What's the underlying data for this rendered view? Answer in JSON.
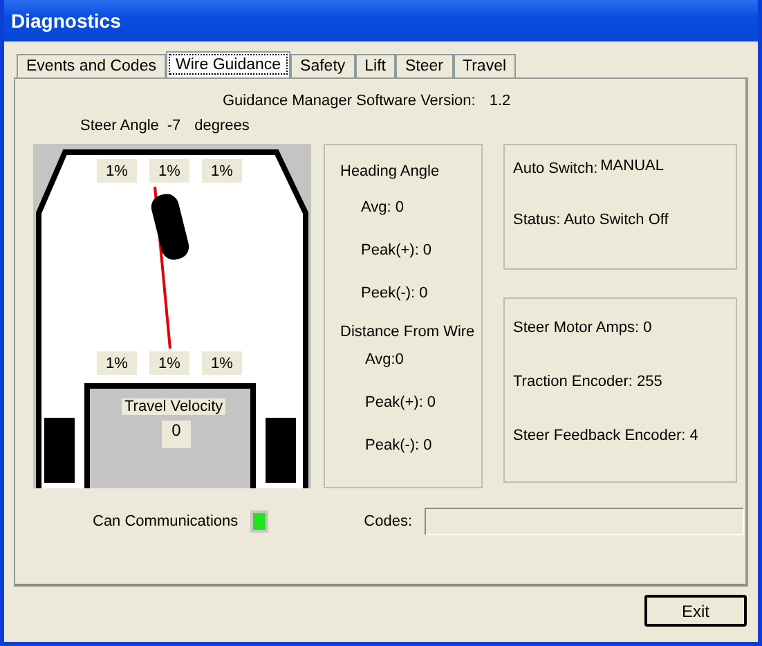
{
  "window": {
    "title": "Diagnostics"
  },
  "tabs": [
    {
      "label": "Events and Codes",
      "selected": false
    },
    {
      "label": "Wire Guidance",
      "selected": true
    },
    {
      "label": "Safety",
      "selected": false
    },
    {
      "label": "Lift",
      "selected": false
    },
    {
      "label": "Steer",
      "selected": false
    },
    {
      "label": "Travel",
      "selected": false
    }
  ],
  "software_version": {
    "label": "Guidance Manager Software Version:",
    "value": "1.2"
  },
  "steer_angle": {
    "label": "Steer Angle",
    "value": "-7",
    "unit": "degrees"
  },
  "diagram": {
    "front_sensors": [
      "1%",
      "1%",
      "1%"
    ],
    "rear_sensors": [
      "1%",
      "1%",
      "1%"
    ],
    "travel_velocity": {
      "label": "Travel Velocity",
      "value": "0"
    }
  },
  "heading_angle": {
    "title": "Heading Angle",
    "rows": [
      "Avg: 0",
      "Peak(+):  0",
      "Peek(-):  0"
    ]
  },
  "distance_from_wire": {
    "title": "Distance From Wire",
    "rows": [
      "Avg:0",
      "Peak(+): 0",
      "Peak(-): 0"
    ]
  },
  "auto_switch": {
    "label": "Auto Switch:",
    "value": "MANUAL",
    "status": "Status:  Auto Switch Off"
  },
  "encoders": [
    "Steer Motor Amps: 0",
    "Traction Encoder:  255",
    "Steer Feedback Encoder:  4"
  ],
  "can_communications": {
    "label": "Can Communications",
    "on": true
  },
  "codes": {
    "label": "Codes:"
  },
  "buttons": [
    "Exit"
  ]
}
